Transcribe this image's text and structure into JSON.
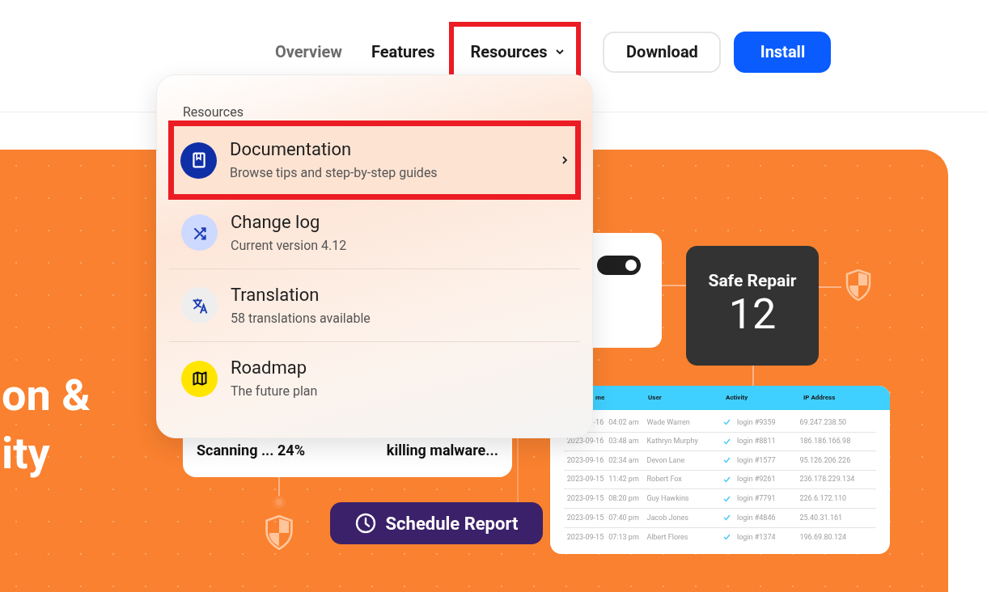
{
  "nav": {
    "links": [
      {
        "label": "Overview",
        "dimmed": true
      },
      {
        "label": "Features",
        "dimmed": false
      },
      {
        "label": "Resources",
        "dimmed": false,
        "expanded": true,
        "annotated": true
      }
    ],
    "buttons": [
      {
        "label": "Download",
        "kind": "outline"
      },
      {
        "label": "Install",
        "kind": "primary"
      }
    ]
  },
  "menu": {
    "heading": "Resources",
    "items": [
      {
        "title": "Documentation",
        "subtitle": "Browse tips and step-by-step guides",
        "kind": "book",
        "color": "#0f2fa6",
        "highlighted": true,
        "annotated": true
      },
      {
        "title": "Change log",
        "subtitle": "Current version 4.12",
        "kind": "shuffle",
        "color": "#cdd9ff",
        "highlighted": false,
        "annotated": false
      },
      {
        "title": "Translation",
        "subtitle": "58 translations available",
        "kind": "translate",
        "color": "#eeeeee",
        "highlighted": false,
        "annotated": false
      },
      {
        "title": "Roadmap",
        "subtitle": "The future plan",
        "kind": "map",
        "color": "#ffe500",
        "highlighted": false,
        "annotated": false
      }
    ]
  },
  "hero": {
    "headline_lines": [
      "on &",
      "ity"
    ],
    "scan_card": {
      "progress": "Scanning ... 24%",
      "status": "killing malware..."
    },
    "toggle": {
      "on": true
    },
    "safe_repair": {
      "title": "Safe Repair",
      "count": "12"
    },
    "schedule_button": "Schedule Report",
    "table": {
      "columns": [
        "me",
        "User",
        "Activity",
        "IP Address"
      ],
      "rows": [
        {
          "date": "-16",
          "time": "04:02 am",
          "user": "Wade Warren",
          "activity": "login #9359",
          "ip": "69.247.238.50"
        },
        {
          "date": "2023-09-16",
          "time": "03:48 am",
          "user": "Kathryn Murphy",
          "activity": "login #8811",
          "ip": "186.186.166.98"
        },
        {
          "date": "2023-09-16",
          "time": "02:34 am",
          "user": "Devon Lane",
          "activity": "login #1577",
          "ip": "95.126.206.226"
        },
        {
          "date": "2023-09-15",
          "time": "11:42 pm",
          "user": "Robert Fox",
          "activity": "login #9261",
          "ip": "236.178.229.134"
        },
        {
          "date": "2023-09-15",
          "time": "08:20 pm",
          "user": "Guy Hawkins",
          "activity": "login #7791",
          "ip": "226.6.172.110"
        },
        {
          "date": "2023-09-15",
          "time": "07:40 pm",
          "user": "Jacob Jones",
          "activity": "login #4846",
          "ip": "25.40.31.161"
        },
        {
          "date": "2023-09-15",
          "time": "07:13 pm",
          "user": "Albert Flores",
          "activity": "login #1374",
          "ip": "196.69.80.124"
        }
      ]
    }
  }
}
